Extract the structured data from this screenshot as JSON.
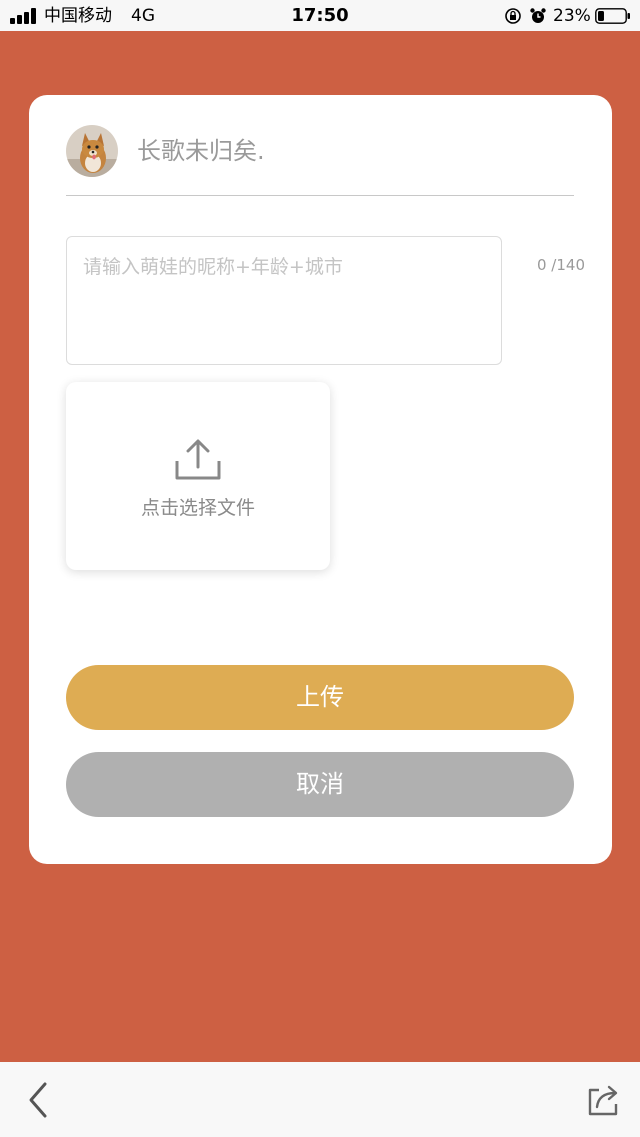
{
  "status_bar": {
    "carrier": "中国移动",
    "network": "4G",
    "time": "17:50",
    "battery_percent": "23%",
    "battery_level": 0.23,
    "icons": [
      "signal-icon",
      "orientation-lock-icon",
      "alarm-icon",
      "battery-icon"
    ]
  },
  "colors": {
    "background": "#cd6043",
    "upload_button": "#deac53",
    "cancel_button": "#b0b0b0"
  },
  "user": {
    "name": "长歌未归矣."
  },
  "form": {
    "placeholder": "请输入萌娃的昵称+年龄+城市",
    "char_count": "0 /140",
    "upload_label": "点击选择文件"
  },
  "buttons": {
    "upload": "上传",
    "cancel": "取消"
  },
  "toolbar": {
    "icons": [
      "back-icon",
      "share-icon"
    ]
  }
}
